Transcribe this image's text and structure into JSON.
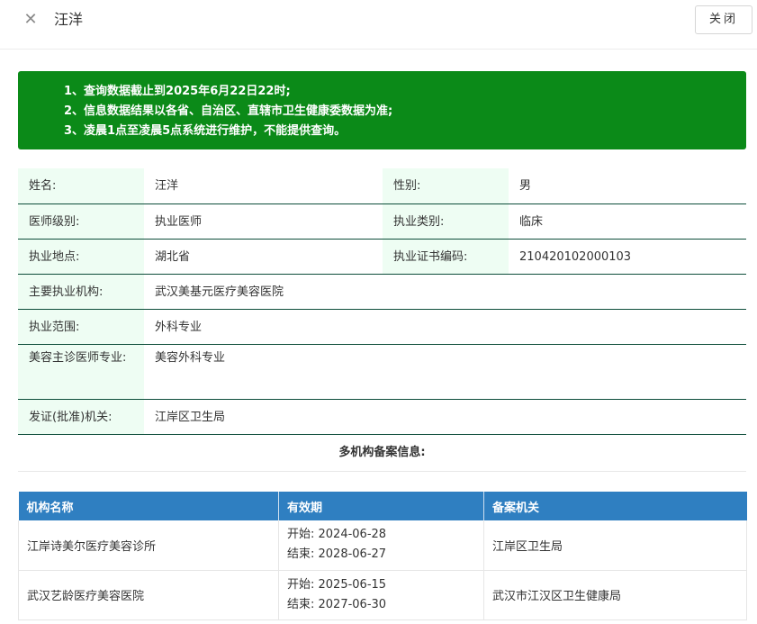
{
  "header": {
    "close_icon": "close-icon",
    "title": "汪洋",
    "close_button": "关闭"
  },
  "notice": {
    "lines": [
      "1、查询数据截止到2025年6月22日22时;",
      "2、信息数据结果以各省、自治区、直辖市卫生健康委数据为准;",
      "3、凌晨1点至凌晨5点系统进行维护，不能提供查询。"
    ],
    "background": "#0b8a18"
  },
  "info": {
    "name_label": "姓名:",
    "name_value": "汪洋",
    "gender_label": "性别:",
    "gender_value": "男",
    "level_label": "医师级别:",
    "level_value": "执业医师",
    "category_label": "执业类别:",
    "category_value": "临床",
    "location_label": "执业地点:",
    "location_value": "湖北省",
    "cert_label": "执业证书编码:",
    "cert_value": "210420102000103",
    "org_label": "主要执业机构:",
    "org_value": "武汉美基元医疗美容医院",
    "scope_label": "执业范围:",
    "scope_value": "外科专业",
    "cosmetic_label": "美容主诊医师专业:",
    "cosmetic_value": "美容外科专业",
    "issuer_label": "发证(批准)机关:",
    "issuer_value": "江岸区卫生局",
    "label_background": "#eefdf3",
    "border_color": "#0d4d3a"
  },
  "records": {
    "title": "多机构备案信息:",
    "columns": [
      "机构名称",
      "有效期",
      "备案机关"
    ],
    "header_background": "#2f7fc1",
    "rows": [
      {
        "name": "江岸诗美尔医疗美容诊所",
        "start": "开始: 2024-06-28",
        "end": "结束: 2028-06-27",
        "authority": "江岸区卫生局"
      },
      {
        "name": "武汉艺龄医疗美容医院",
        "start": "开始: 2025-06-15",
        "end": "结束: 2027-06-30",
        "authority": "武汉市江汉区卫生健康局"
      }
    ]
  }
}
